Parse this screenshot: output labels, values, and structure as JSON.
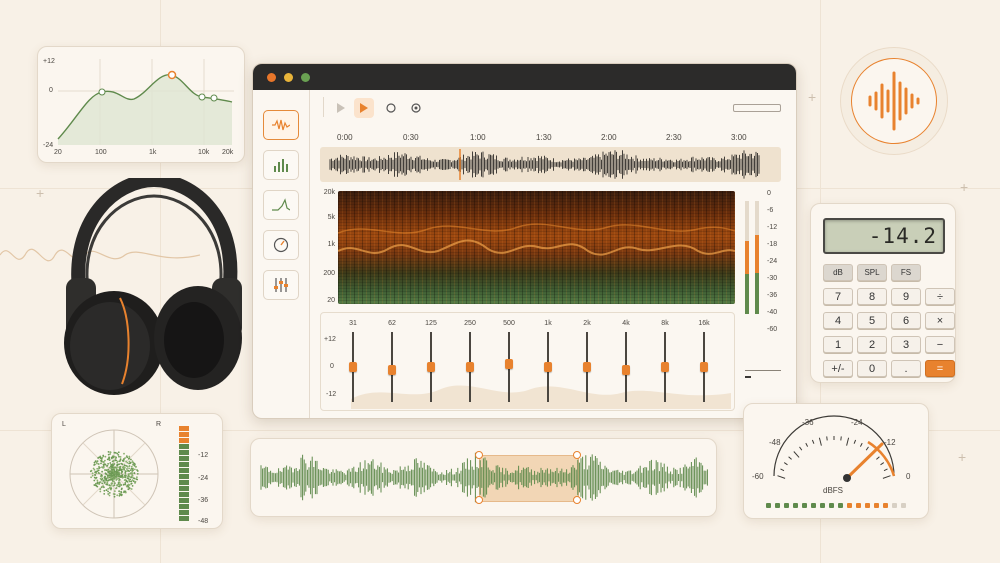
{
  "colors": {
    "accent": "#e8822e",
    "green": "#5f8a4c",
    "dark": "#2c2b2a",
    "bg": "#f8f1e7"
  },
  "eq_curve": {
    "y_ticks": [
      "+12",
      "0",
      "-24"
    ],
    "x_ticks": [
      "20",
      "100",
      "1k",
      "10k",
      "20k"
    ]
  },
  "window": {
    "controls": [
      "close",
      "minimize",
      "zoom"
    ],
    "toolbar": {
      "icons": [
        "play-icon",
        "play-active-icon",
        "record-icon",
        "loop-icon"
      ]
    },
    "sidebar": {
      "icons": [
        "waveform-icon",
        "bars-icon",
        "envelope-icon",
        "gauge-icon",
        "mixer-icon"
      ]
    },
    "timeline": [
      "0:00",
      "0:30",
      "1:00",
      "1:30",
      "2:00",
      "2:30",
      "3:00"
    ],
    "spectrogram_freqs": [
      "20k",
      "5k",
      "1k",
      "200",
      "20"
    ],
    "level_meter": {
      "ticks": [
        "0",
        "-6",
        "-12",
        "-18",
        "-24",
        "-30",
        "-36",
        "-40",
        "-60"
      ]
    },
    "equalizer": {
      "bands": [
        "31",
        "62",
        "125",
        "250",
        "500",
        "1k",
        "2k",
        "4k",
        "8k",
        "16k"
      ],
      "gains_db": [
        0,
        -1,
        0,
        0,
        1,
        0,
        0,
        -1,
        0,
        0
      ],
      "y_ticks": [
        "+12",
        "0",
        "-12"
      ]
    }
  },
  "calculator": {
    "display": "-14.2",
    "keys": [
      [
        "dB",
        "SPL",
        "FS"
      ],
      [
        "7",
        "8",
        "9",
        "÷"
      ],
      [
        "4",
        "5",
        "6",
        "×"
      ],
      [
        "1",
        "2",
        "3",
        "−"
      ],
      [
        "+/-",
        "0",
        ".",
        "="
      ]
    ]
  },
  "vu_meter": {
    "ticks": [
      "-60",
      "-48",
      "-36",
      "-24",
      "-12",
      "0"
    ],
    "unit": "dBFS",
    "needle_value": -12
  },
  "vectorscope": {
    "channels": [
      "L",
      "R"
    ],
    "ticks": [
      "-12",
      "-24",
      "-36",
      "-48"
    ]
  }
}
